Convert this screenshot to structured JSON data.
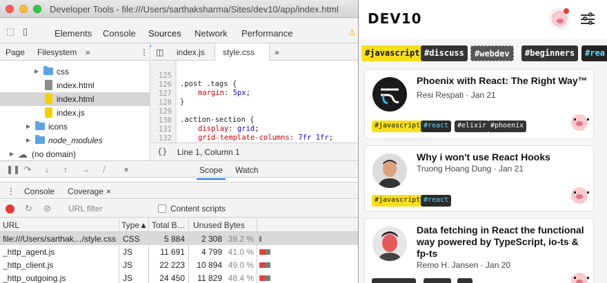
{
  "window": {
    "title": "Developer Tools - file:///Users/sarthaksharma/Sites/dev10/app/index.html"
  },
  "devtools": {
    "panels": [
      "Elements",
      "Console",
      "Sources",
      "Network",
      "Performance"
    ],
    "active_panel": "Sources",
    "navigator_tabs": [
      "Page",
      "Filesystem"
    ],
    "tree": [
      {
        "label": "css",
        "type": "folder"
      },
      {
        "label": "index.html",
        "type": "file-gray"
      },
      {
        "label": "index.html",
        "type": "file-yellow",
        "selected": true
      },
      {
        "label": "index.js",
        "type": "file-yellow"
      },
      {
        "label": "icons",
        "type": "folder"
      },
      {
        "label": "node_modules",
        "type": "folder"
      },
      {
        "label": "(no domain)",
        "type": "cloud"
      }
    ],
    "editor_tabs": [
      "index.js",
      "style.css"
    ],
    "active_editor_tab": "style.css",
    "code": [
      {
        "ln": "125",
        "text": ".post .tags {"
      },
      {
        "ln": "126",
        "prop": "margin",
        "val": "5px"
      },
      {
        "ln": "127",
        "text": "}"
      },
      {
        "ln": "128",
        "text": ""
      },
      {
        "ln": "129",
        "text": ".action-section {"
      },
      {
        "ln": "130",
        "prop": "display",
        "val": "grid"
      },
      {
        "ln": "131",
        "prop": "grid-template-columns",
        "val": "7fr 1fr"
      },
      {
        "ln": "132",
        "text": "}"
      }
    ],
    "cursor_position": "Line 1, Column 1",
    "braces": "{}",
    "debugger_tabs": [
      "Scope",
      "Watch"
    ],
    "drawer_tabs": [
      "Console",
      "Coverage"
    ],
    "coverage": {
      "filter_placeholder": "URL filter",
      "content_scripts_label": "Content scripts",
      "columns": [
        "URL",
        "Type",
        "Total B…",
        "Unused Bytes"
      ],
      "rows": [
        {
          "url": "file:///Users/sarthak…/style.css",
          "type": "CSS",
          "total": "5 884",
          "unused": "2 308",
          "pct": "39.2 %",
          "unused_frac": 0.392,
          "selected": true
        },
        {
          "url": "_http_agent.js",
          "type": "JS",
          "total": "11 691",
          "unused": "4 799",
          "pct": "41.0 %",
          "unused_frac": 0.41
        },
        {
          "url": "_http_client.js",
          "type": "JS",
          "total": "22 223",
          "unused": "10 894",
          "pct": "49.0 %",
          "unused_frac": 0.49
        },
        {
          "url": "_http_outgoing.js",
          "type": "JS",
          "total": "24 450",
          "unused": "11 829",
          "pct": "48.4 %",
          "unused_frac": 0.484
        }
      ]
    }
  },
  "devto": {
    "logo": "DEV10",
    "tags": [
      "#javascript",
      "#discuss",
      "#webdev",
      "#beginners",
      "#rea"
    ],
    "cards": [
      {
        "title": "Phoenix with React: The Right Way™",
        "meta": "Resi Respati · Jan 21",
        "tags": [
          "#javascript",
          "#react",
          "#elixir",
          "#phoenix"
        ]
      },
      {
        "title": "Why i won't use React Hooks",
        "meta": "Truong Hoang Dung · Jan 21",
        "tags": [
          "#javascript",
          "#react"
        ]
      },
      {
        "title": "Data fetching in React the functional way powered by TypeScript, io-ts & fp-ts",
        "meta": "Remo H. Jansen · Jan 20",
        "tags": []
      }
    ]
  }
}
